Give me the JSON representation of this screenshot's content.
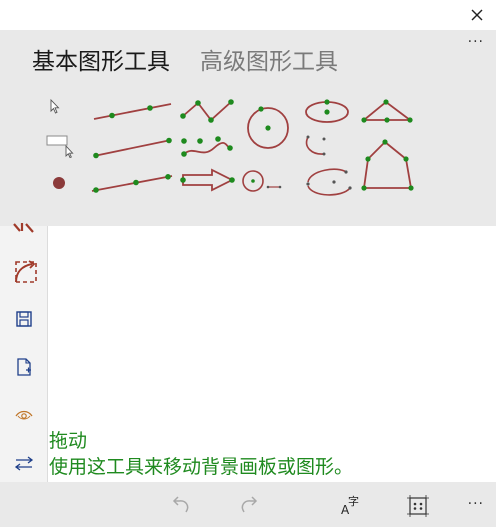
{
  "tabs": [
    {
      "label": "基本图形工具",
      "selected": true
    },
    {
      "label": "高级图形工具",
      "selected": false
    }
  ],
  "more_label": "···",
  "help": {
    "title": "拖动",
    "description": "使用这工具来移动背景画板或图形。"
  },
  "toolbar": {
    "more_label": "···"
  },
  "colors": {
    "panel_bg": "#e9e9e9",
    "shape_stroke": "#a04040",
    "point_fill": "#1e8a1e",
    "help_text": "#1f8a1f"
  }
}
